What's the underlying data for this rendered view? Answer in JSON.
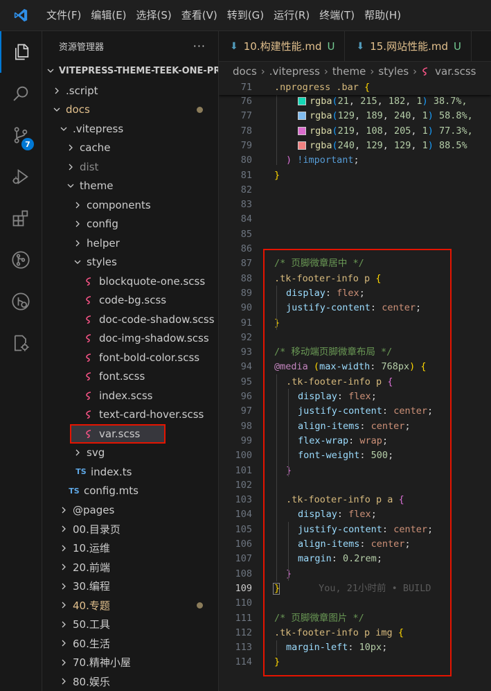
{
  "menu": [
    "文件(F)",
    "编辑(E)",
    "选择(S)",
    "查看(V)",
    "转到(G)",
    "运行(R)",
    "终端(T)",
    "帮助(H)"
  ],
  "activity": {
    "icons": [
      "explorer-icon",
      "search-icon",
      "source-control-icon",
      "run-debug-icon",
      "extensions-icon",
      "git-graph-icon",
      "remote-explorer-icon",
      "docker-icon"
    ],
    "scm_badge": "7"
  },
  "sidebar": {
    "title": "资源管理器",
    "more": "···",
    "project": "VITEPRESS-THEME-TEEK-ONE-PR...",
    "tree": [
      {
        "label": ".script",
        "type": "folder",
        "open": false,
        "depth": 1
      },
      {
        "label": "docs",
        "type": "folder",
        "open": true,
        "depth": 1,
        "modified": true
      },
      {
        "label": ".vitepress",
        "type": "folder",
        "open": true,
        "depth": 2
      },
      {
        "label": "cache",
        "type": "folder",
        "open": false,
        "depth": 3
      },
      {
        "label": "dist",
        "type": "folder",
        "open": false,
        "depth": 3,
        "dim": true
      },
      {
        "label": "theme",
        "type": "folder",
        "open": true,
        "depth": 3
      },
      {
        "label": "components",
        "type": "folder",
        "open": false,
        "depth": 4
      },
      {
        "label": "config",
        "type": "folder",
        "open": false,
        "depth": 4
      },
      {
        "label": "helper",
        "type": "folder",
        "open": false,
        "depth": 4
      },
      {
        "label": "styles",
        "type": "folder",
        "open": true,
        "depth": 4
      },
      {
        "label": "blockquote-one.scss",
        "type": "scss",
        "depth": 5
      },
      {
        "label": "code-bg.scss",
        "type": "scss",
        "depth": 5
      },
      {
        "label": "doc-code-shadow.scss",
        "type": "scss",
        "depth": 5
      },
      {
        "label": "doc-img-shadow.scss",
        "type": "scss",
        "depth": 5
      },
      {
        "label": "font-bold-color.scss",
        "type": "scss",
        "depth": 5
      },
      {
        "label": "font.scss",
        "type": "scss",
        "depth": 5
      },
      {
        "label": "index.scss",
        "type": "scss",
        "depth": 5
      },
      {
        "label": "text-card-hover.scss",
        "type": "scss",
        "depth": 5
      },
      {
        "label": "var.scss",
        "type": "scss",
        "depth": 5,
        "active": true
      },
      {
        "label": "svg",
        "type": "folder",
        "open": false,
        "depth": 4
      },
      {
        "label": "index.ts",
        "type": "ts",
        "depth": 4
      },
      {
        "label": "config.mts",
        "type": "ts",
        "depth": 3
      },
      {
        "label": "@pages",
        "type": "folder",
        "open": false,
        "depth": 2
      },
      {
        "label": "00.目录页",
        "type": "folder",
        "open": false,
        "depth": 2
      },
      {
        "label": "10.运维",
        "type": "folder",
        "open": false,
        "depth": 2
      },
      {
        "label": "20.前端",
        "type": "folder",
        "open": false,
        "depth": 2
      },
      {
        "label": "30.编程",
        "type": "folder",
        "open": false,
        "depth": 2
      },
      {
        "label": "40.专题",
        "type": "folder",
        "open": false,
        "depth": 2,
        "modified": true
      },
      {
        "label": "50.工具",
        "type": "folder",
        "open": false,
        "depth": 2
      },
      {
        "label": "60.生活",
        "type": "folder",
        "open": false,
        "depth": 2
      },
      {
        "label": "70.精神小屋",
        "type": "folder",
        "open": false,
        "depth": 2
      },
      {
        "label": "80.娱乐",
        "type": "folder",
        "open": false,
        "depth": 2
      }
    ],
    "ts_badge": "TS"
  },
  "tabs": [
    {
      "label": "10.构建性能.md",
      "status": "U"
    },
    {
      "label": "15.网站性能.md",
      "status": "U"
    }
  ],
  "breadcrumb": [
    "docs",
    ".vitepress",
    "theme",
    "styles",
    "var.scss"
  ],
  "editor": {
    "blame": "You, 21小时前 • BUILD",
    "lines": [
      {
        "n": "71",
        "sticky": true,
        "tokens": [
          [
            ".nprogress .bar ",
            "sel"
          ],
          [
            "{",
            "p1"
          ]
        ]
      },
      {
        "n": "76",
        "indent": 2,
        "swatch": "#15d7b6",
        "tokens": [
          [
            "rgba",
            "fn"
          ],
          [
            "(",
            "p3"
          ],
          [
            "21",
            "num"
          ],
          [
            ", ",
            ""
          ],
          [
            "215",
            "num"
          ],
          [
            ", ",
            ""
          ],
          [
            "182",
            "num"
          ],
          [
            ", ",
            ""
          ],
          [
            "1",
            "num"
          ],
          [
            ")",
            "p3"
          ],
          [
            " 38.7%,",
            "num"
          ]
        ]
      },
      {
        "n": "77",
        "indent": 2,
        "swatch": "#81bdf0",
        "tokens": [
          [
            "rgba",
            "fn"
          ],
          [
            "(",
            "p3"
          ],
          [
            "129",
            "num"
          ],
          [
            ", ",
            ""
          ],
          [
            "189",
            "num"
          ],
          [
            ", ",
            ""
          ],
          [
            "240",
            "num"
          ],
          [
            ", ",
            ""
          ],
          [
            "1",
            "num"
          ],
          [
            ")",
            "p3"
          ],
          [
            " 58.8%,",
            "num"
          ]
        ]
      },
      {
        "n": "78",
        "indent": 2,
        "swatch": "#db6ccd",
        "tokens": [
          [
            "rgba",
            "fn"
          ],
          [
            "(",
            "p3"
          ],
          [
            "219",
            "num"
          ],
          [
            ", ",
            ""
          ],
          [
            "108",
            "num"
          ],
          [
            ", ",
            ""
          ],
          [
            "205",
            "num"
          ],
          [
            ", ",
            ""
          ],
          [
            "1",
            "num"
          ],
          [
            ")",
            "p3"
          ],
          [
            " 77.3%,",
            "num"
          ]
        ]
      },
      {
        "n": "79",
        "indent": 2,
        "swatch": "#f08181",
        "tokens": [
          [
            "rgba",
            "fn"
          ],
          [
            "(",
            "p3"
          ],
          [
            "240",
            "num"
          ],
          [
            ", ",
            ""
          ],
          [
            "129",
            "num"
          ],
          [
            ", ",
            ""
          ],
          [
            "129",
            "num"
          ],
          [
            ", ",
            ""
          ],
          [
            "1",
            "num"
          ],
          [
            ")",
            "p3"
          ],
          [
            " 88.5%",
            "num"
          ]
        ]
      },
      {
        "n": "80",
        "indent": 1,
        "tokens": [
          [
            ")",
            "p2"
          ],
          [
            " !important",
            "kw"
          ],
          [
            ";",
            ""
          ]
        ]
      },
      {
        "n": "81",
        "indent": 0,
        "tokens": [
          [
            "}",
            "p1"
          ]
        ]
      },
      {
        "n": "82",
        "tokens": []
      },
      {
        "n": "83",
        "tokens": []
      },
      {
        "n": "84",
        "tokens": []
      },
      {
        "n": "85",
        "tokens": []
      },
      {
        "n": "86",
        "tokens": []
      },
      {
        "n": "87",
        "indent": 0,
        "tokens": [
          [
            "/* 页脚微章居中 */",
            "cmt"
          ]
        ]
      },
      {
        "n": "88",
        "indent": 0,
        "tokens": [
          [
            ".tk-footer-info p ",
            "sel"
          ],
          [
            "{",
            "p1"
          ]
        ]
      },
      {
        "n": "89",
        "indent": 1,
        "tokens": [
          [
            "display",
            "prop"
          ],
          [
            ": ",
            ""
          ],
          [
            "flex",
            "val"
          ],
          [
            ";",
            ""
          ]
        ]
      },
      {
        "n": "90",
        "indent": 1,
        "tokens": [
          [
            "justify-content",
            "prop"
          ],
          [
            ": ",
            ""
          ],
          [
            "center",
            "val"
          ],
          [
            ";",
            ""
          ]
        ]
      },
      {
        "n": "91",
        "indent": 0,
        "tokens": [
          [
            "}",
            "p1"
          ]
        ]
      },
      {
        "n": "92",
        "tokens": []
      },
      {
        "n": "93",
        "indent": 0,
        "tokens": [
          [
            "/* 移动端页脚微章布局 */",
            "cmt"
          ]
        ]
      },
      {
        "n": "94",
        "indent": 0,
        "tokens": [
          [
            "@media",
            "at"
          ],
          [
            " ",
            ""
          ],
          [
            "(",
            "p1"
          ],
          [
            "max-width",
            "prop"
          ],
          [
            ": ",
            ""
          ],
          [
            "768px",
            "num"
          ],
          [
            ")",
            "p1"
          ],
          [
            " ",
            ""
          ],
          [
            "{",
            "p1"
          ]
        ]
      },
      {
        "n": "95",
        "indent": 1,
        "tokens": [
          [
            ".tk-footer-info p ",
            "sel"
          ],
          [
            "{",
            "p2"
          ]
        ]
      },
      {
        "n": "96",
        "indent": 2,
        "tokens": [
          [
            "display",
            "prop"
          ],
          [
            ": ",
            ""
          ],
          [
            "flex",
            "val"
          ],
          [
            ";",
            ""
          ]
        ]
      },
      {
        "n": "97",
        "indent": 2,
        "tokens": [
          [
            "justify-content",
            "prop"
          ],
          [
            ": ",
            ""
          ],
          [
            "center",
            "val"
          ],
          [
            ";",
            ""
          ]
        ]
      },
      {
        "n": "98",
        "indent": 2,
        "tokens": [
          [
            "align-items",
            "prop"
          ],
          [
            ": ",
            ""
          ],
          [
            "center",
            "val"
          ],
          [
            ";",
            ""
          ]
        ]
      },
      {
        "n": "99",
        "indent": 2,
        "tokens": [
          [
            "flex-wrap",
            "prop"
          ],
          [
            ": ",
            ""
          ],
          [
            "wrap",
            "val"
          ],
          [
            ";",
            ""
          ]
        ]
      },
      {
        "n": "100",
        "indent": 2,
        "tokens": [
          [
            "font-weight",
            "prop"
          ],
          [
            ": ",
            ""
          ],
          [
            "500",
            "num"
          ],
          [
            ";",
            ""
          ]
        ]
      },
      {
        "n": "101",
        "indent": 1,
        "tokens": [
          [
            "}",
            "p2"
          ]
        ]
      },
      {
        "n": "102",
        "tokens": []
      },
      {
        "n": "103",
        "indent": 1,
        "tokens": [
          [
            ".tk-footer-info p a ",
            "sel"
          ],
          [
            "{",
            "p2"
          ]
        ]
      },
      {
        "n": "104",
        "indent": 2,
        "tokens": [
          [
            "display",
            "prop"
          ],
          [
            ": ",
            ""
          ],
          [
            "flex",
            "val"
          ],
          [
            ";",
            ""
          ]
        ]
      },
      {
        "n": "105",
        "indent": 2,
        "tokens": [
          [
            "justify-content",
            "prop"
          ],
          [
            ": ",
            ""
          ],
          [
            "center",
            "val"
          ],
          [
            ";",
            ""
          ]
        ]
      },
      {
        "n": "106",
        "indent": 2,
        "tokens": [
          [
            "align-items",
            "prop"
          ],
          [
            ": ",
            ""
          ],
          [
            "center",
            "val"
          ],
          [
            ";",
            ""
          ]
        ]
      },
      {
        "n": "107",
        "indent": 2,
        "tokens": [
          [
            "margin",
            "prop"
          ],
          [
            ": ",
            ""
          ],
          [
            "0.2rem",
            "num"
          ],
          [
            ";",
            ""
          ]
        ]
      },
      {
        "n": "108",
        "indent": 1,
        "tokens": [
          [
            "}",
            "p2"
          ]
        ]
      },
      {
        "n": "109",
        "indent": 0,
        "current": true,
        "blame": true,
        "tokens": [
          [
            "}",
            "p1"
          ]
        ]
      },
      {
        "n": "110",
        "tokens": []
      },
      {
        "n": "111",
        "indent": 0,
        "tokens": [
          [
            "/* 页脚微章图片 */",
            "cmt"
          ]
        ]
      },
      {
        "n": "112",
        "indent": 0,
        "tokens": [
          [
            ".tk-footer-info p img ",
            "sel"
          ],
          [
            "{",
            "p1"
          ]
        ]
      },
      {
        "n": "113",
        "indent": 1,
        "tokens": [
          [
            "margin-left",
            "prop"
          ],
          [
            ": ",
            ""
          ],
          [
            "10px",
            "num"
          ],
          [
            ";",
            ""
          ]
        ]
      },
      {
        "n": "114",
        "indent": 0,
        "tokens": [
          [
            "}",
            "p1"
          ]
        ]
      }
    ]
  },
  "colors": {
    "accent": "#0078d4",
    "highlight_border": "#e51400",
    "untracked": "#73c991",
    "modified": "#e2c08d"
  }
}
